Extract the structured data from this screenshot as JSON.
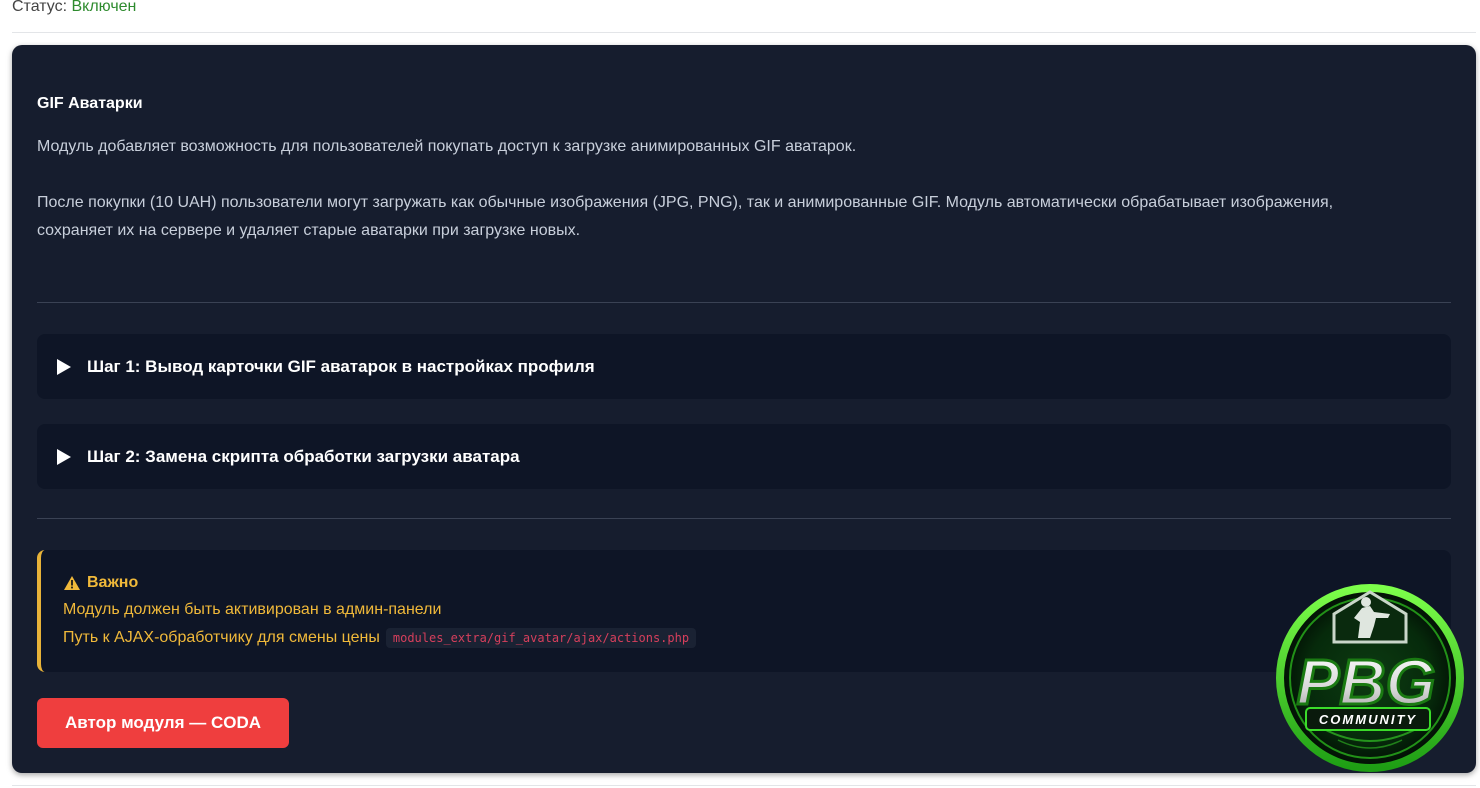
{
  "status": {
    "label": "Статус:",
    "value": "Включен"
  },
  "card": {
    "title": "GIF Аватарки",
    "description_1": "Модуль добавляет возможность для пользователей покупать доступ к загрузке анимированных GIF аватарок.",
    "description_2": "После покупки (10 UAH) пользователи могут загружать как обычные изображения (JPG, PNG), так и анимированные GIF. Модуль автоматически обрабатывает изображения, сохраняет их на сервере и удаляет старые аватарки при загрузке новых.",
    "steps": [
      {
        "label": "Шаг 1: Вывод карточки GIF аватарок в настройках профиля"
      },
      {
        "label": "Шаг 2: Замена скрипта обработки загрузки аватара"
      }
    ],
    "notice": {
      "icon": "warning-icon",
      "title": "Важно",
      "line_1": "Модуль должен быть активирован в админ-панели",
      "line_2": "Путь к AJAX-обработчику для смены цены",
      "code": "modules_extra/gif_avatar/ajax/actions.php"
    },
    "author_button": "Автор модуля — CODA"
  },
  "logo": {
    "text_main": "PBG",
    "text_sub": "COMMUNITY"
  },
  "colors": {
    "card_bg": "#161d2e",
    "step_bg": "#0e1526",
    "notice_accent": "#f0b93a",
    "button_bg": "#ef3e3e",
    "status_on": "#2e8b2e",
    "code_text": "#d63f5c",
    "logo_green": "#3bdc2a"
  }
}
